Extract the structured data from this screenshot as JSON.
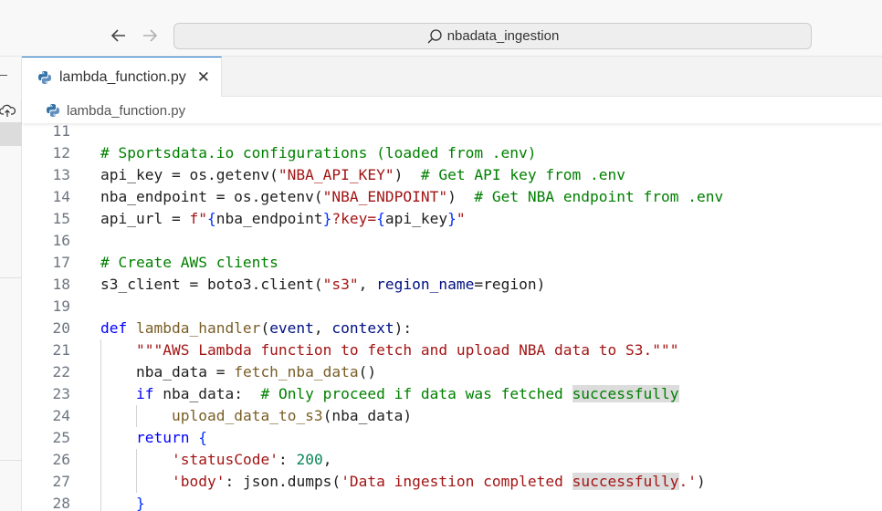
{
  "titlebar": {
    "back_icon": "arrow-left-icon",
    "forward_icon": "arrow-right-icon",
    "search_text": "nbadata_ingestion"
  },
  "tab": {
    "label": "lambda_function.py",
    "close_glyph": "✕"
  },
  "breadcrumb": {
    "file": "lambda_function.py"
  },
  "colors": {
    "keyword": "#0000ff",
    "comment": "#008000",
    "string": "#a31515",
    "function": "#795e26",
    "parameter": "#001080",
    "number": "#098658",
    "bracket": "#0431fa",
    "highlight": "#dcdcdc"
  },
  "code_lines": [
    {
      "n": "11",
      "indent": 0,
      "tokens": []
    },
    {
      "n": "12",
      "indent": 0,
      "tokens": [
        {
          "t": "# Sportsdata.io configurations (loaded from .env)",
          "c": "cm"
        }
      ]
    },
    {
      "n": "13",
      "indent": 0,
      "tokens": [
        {
          "t": "api_key = os.getenv(",
          "c": ""
        },
        {
          "t": "\"NBA_API_KEY\"",
          "c": "st"
        },
        {
          "t": ")  ",
          "c": ""
        },
        {
          "t": "# Get API key from .env",
          "c": "cm"
        }
      ]
    },
    {
      "n": "14",
      "indent": 0,
      "tokens": [
        {
          "t": "nba_endpoint = os.getenv(",
          "c": ""
        },
        {
          "t": "\"NBA_ENDPOINT\"",
          "c": "st"
        },
        {
          "t": ")  ",
          "c": ""
        },
        {
          "t": "# Get NBA endpoint from .env",
          "c": "cm"
        }
      ]
    },
    {
      "n": "15",
      "indent": 0,
      "tokens": [
        {
          "t": "api_url = ",
          "c": ""
        },
        {
          "t": "f\"",
          "c": "st"
        },
        {
          "t": "{",
          "c": "br"
        },
        {
          "t": "nba_endpoint",
          "c": ""
        },
        {
          "t": "}",
          "c": "br"
        },
        {
          "t": "?key=",
          "c": "st"
        },
        {
          "t": "{",
          "c": "br"
        },
        {
          "t": "api_key",
          "c": ""
        },
        {
          "t": "}",
          "c": "br"
        },
        {
          "t": "\"",
          "c": "st"
        }
      ]
    },
    {
      "n": "16",
      "indent": 0,
      "tokens": []
    },
    {
      "n": "17",
      "indent": 0,
      "tokens": [
        {
          "t": "# Create AWS clients",
          "c": "cm"
        }
      ]
    },
    {
      "n": "18",
      "indent": 0,
      "tokens": [
        {
          "t": "s3_client = boto3.client(",
          "c": ""
        },
        {
          "t": "\"s3\"",
          "c": "st"
        },
        {
          "t": ", ",
          "c": ""
        },
        {
          "t": "region_name",
          "c": "pm"
        },
        {
          "t": "=region)",
          "c": ""
        }
      ]
    },
    {
      "n": "19",
      "indent": 0,
      "tokens": []
    },
    {
      "n": "20",
      "indent": 0,
      "tokens": [
        {
          "t": "def ",
          "c": "kw"
        },
        {
          "t": "lambda_handler",
          "c": "fn"
        },
        {
          "t": "(",
          "c": ""
        },
        {
          "t": "event",
          "c": "pm"
        },
        {
          "t": ", ",
          "c": ""
        },
        {
          "t": "context",
          "c": "pm"
        },
        {
          "t": "):",
          "c": ""
        }
      ]
    },
    {
      "n": "21",
      "indent": 1,
      "tokens": [
        {
          "t": "\"\"\"AWS Lambda function to fetch and upload NBA data to S3.\"\"\"",
          "c": "st"
        }
      ]
    },
    {
      "n": "22",
      "indent": 1,
      "tokens": [
        {
          "t": "nba_data = ",
          "c": ""
        },
        {
          "t": "fetch_nba_data",
          "c": "fn"
        },
        {
          "t": "()",
          "c": ""
        }
      ]
    },
    {
      "n": "23",
      "indent": 1,
      "tokens": [
        {
          "t": "if ",
          "c": "kw"
        },
        {
          "t": "nba_data:  ",
          "c": ""
        },
        {
          "t": "# Only proceed if data was fetched ",
          "c": "cm"
        },
        {
          "t": "successfully",
          "c": "cm hl"
        }
      ]
    },
    {
      "n": "24",
      "indent": 2,
      "tokens": [
        {
          "t": "upload_data_to_s3",
          "c": "fn"
        },
        {
          "t": "(nba_data)",
          "c": ""
        }
      ]
    },
    {
      "n": "25",
      "indent": 1,
      "tokens": [
        {
          "t": "return ",
          "c": "kw"
        },
        {
          "t": "{",
          "c": "br"
        }
      ]
    },
    {
      "n": "26",
      "indent": 2,
      "tokens": [
        {
          "t": "'statusCode'",
          "c": "st"
        },
        {
          "t": ": ",
          "c": ""
        },
        {
          "t": "200",
          "c": "nm"
        },
        {
          "t": ",",
          "c": ""
        }
      ]
    },
    {
      "n": "27",
      "indent": 2,
      "tokens": [
        {
          "t": "'body'",
          "c": "st"
        },
        {
          "t": ": json.dumps(",
          "c": ""
        },
        {
          "t": "'Data ingestion completed ",
          "c": "st"
        },
        {
          "t": "successfully",
          "c": "st hl"
        },
        {
          "t": ".'",
          "c": "st"
        },
        {
          "t": ")",
          "c": ""
        }
      ]
    },
    {
      "n": "28",
      "indent": 1,
      "tokens": [
        {
          "t": "}",
          "c": "br"
        }
      ]
    }
  ]
}
